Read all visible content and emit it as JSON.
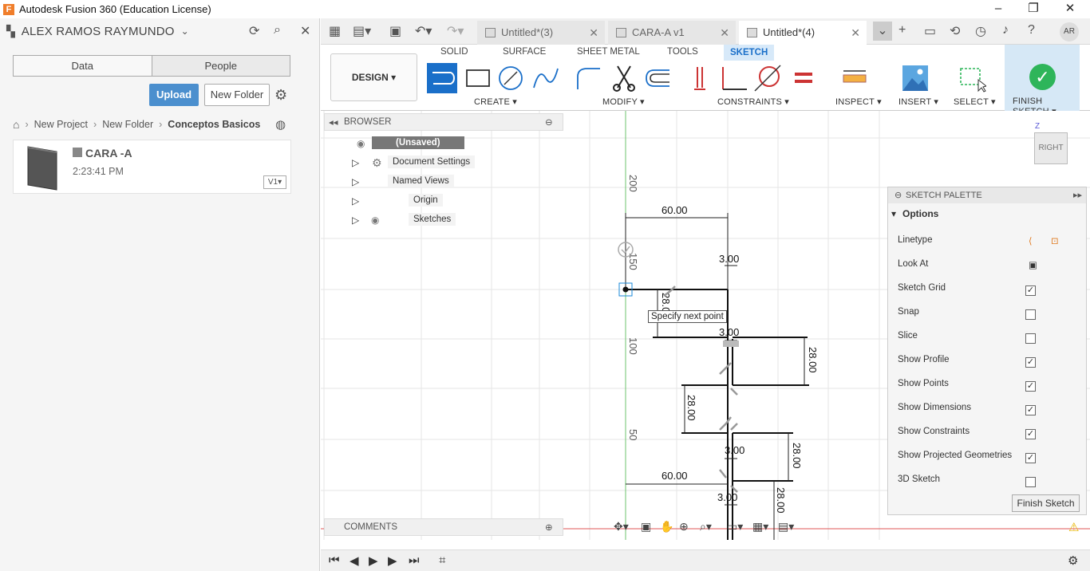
{
  "window": {
    "title": "Autodesk Fusion 360 (Education License)",
    "logo_letter": "F"
  },
  "datapanel": {
    "user": "ALEX RAMOS RAYMUNDO",
    "tabs": [
      "Data",
      "People"
    ],
    "upload": "Upload",
    "new_folder": "New Folder",
    "breadcrumb": [
      "New Project",
      "New Folder",
      "Conceptos Basicos"
    ],
    "file": {
      "name": "CARA -A",
      "time": "2:23:41 PM",
      "version": "V1"
    }
  },
  "doctabs": [
    {
      "label": "Untitled*(3)"
    },
    {
      "label": "CARA-A v1"
    },
    {
      "label": "Untitled*(4)"
    }
  ],
  "user_initials": "AR",
  "ribbon": {
    "workspace": "DESIGN",
    "tabs": [
      "SOLID",
      "SURFACE",
      "SHEET METAL",
      "TOOLS",
      "SKETCH"
    ],
    "groups": [
      "CREATE",
      "MODIFY",
      "CONSTRAINTS",
      "INSPECT",
      "INSERT",
      "SELECT",
      "FINISH SKETCH"
    ]
  },
  "browser": {
    "title": "BROWSER",
    "root": "(Unsaved)",
    "items": [
      "Document Settings",
      "Named Views",
      "Origin",
      "Sketches"
    ]
  },
  "comments": "COMMENTS",
  "canvas": {
    "tooltip": "Specify next point",
    "axis_labels": [
      "200",
      "150",
      "100",
      "50"
    ],
    "dimensions": [
      "60.00",
      "3.00",
      "3.00",
      "28.00",
      "28.00",
      "28.00",
      "3.00",
      "60.00",
      "3.00",
      "28.00",
      "28.00"
    ],
    "viewcube": "RIGHT"
  },
  "palette": {
    "title": "SKETCH PALETTE",
    "section": "Options",
    "rows": [
      {
        "label": "Linetype",
        "type": "icons"
      },
      {
        "label": "Look At",
        "type": "icon"
      },
      {
        "label": "Sketch Grid",
        "checked": "✓"
      },
      {
        "label": "Snap",
        "checked": ""
      },
      {
        "label": "Slice",
        "checked": ""
      },
      {
        "label": "Show Profile",
        "checked": "✓"
      },
      {
        "label": "Show Points",
        "checked": "✓"
      },
      {
        "label": "Show Dimensions",
        "checked": "✓"
      },
      {
        "label": "Show Constraints",
        "checked": "✓"
      },
      {
        "label": "Show Projected Geometries",
        "checked": "✓"
      },
      {
        "label": "3D Sketch",
        "checked": ""
      }
    ],
    "finish": "Finish Sketch"
  },
  "colors": {
    "accent": "#1a6fc9",
    "finish_green": "#2eb55a",
    "upload_blue": "#4b8fce"
  }
}
